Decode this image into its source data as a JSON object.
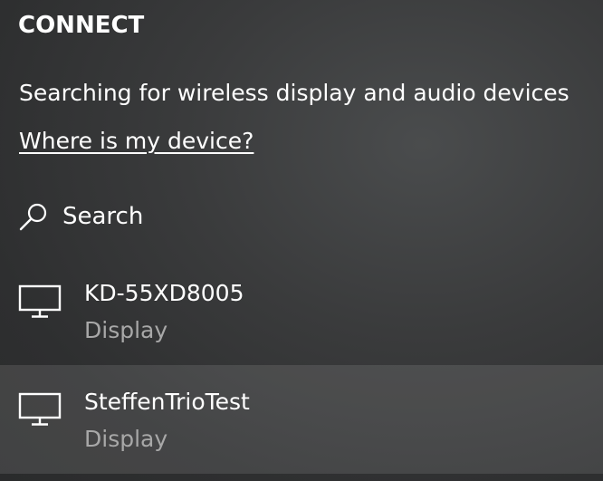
{
  "header": {
    "title": "CONNECT"
  },
  "status": {
    "text": "Searching for wireless display and audio devices"
  },
  "help": {
    "link_text": "Where is my device?"
  },
  "search": {
    "label": "Search",
    "icon": "search-icon"
  },
  "devices": [
    {
      "name": "KD-55XD8005",
      "type": "Display",
      "icon": "monitor-icon",
      "selected": false
    },
    {
      "name": "SteffenTrioTest",
      "type": "Display",
      "icon": "monitor-icon",
      "selected": true
    }
  ],
  "colors": {
    "text": "#ffffff",
    "secondary_text": "#a8a8a8",
    "selected_row": "rgba(255,255,255,0.11)"
  }
}
